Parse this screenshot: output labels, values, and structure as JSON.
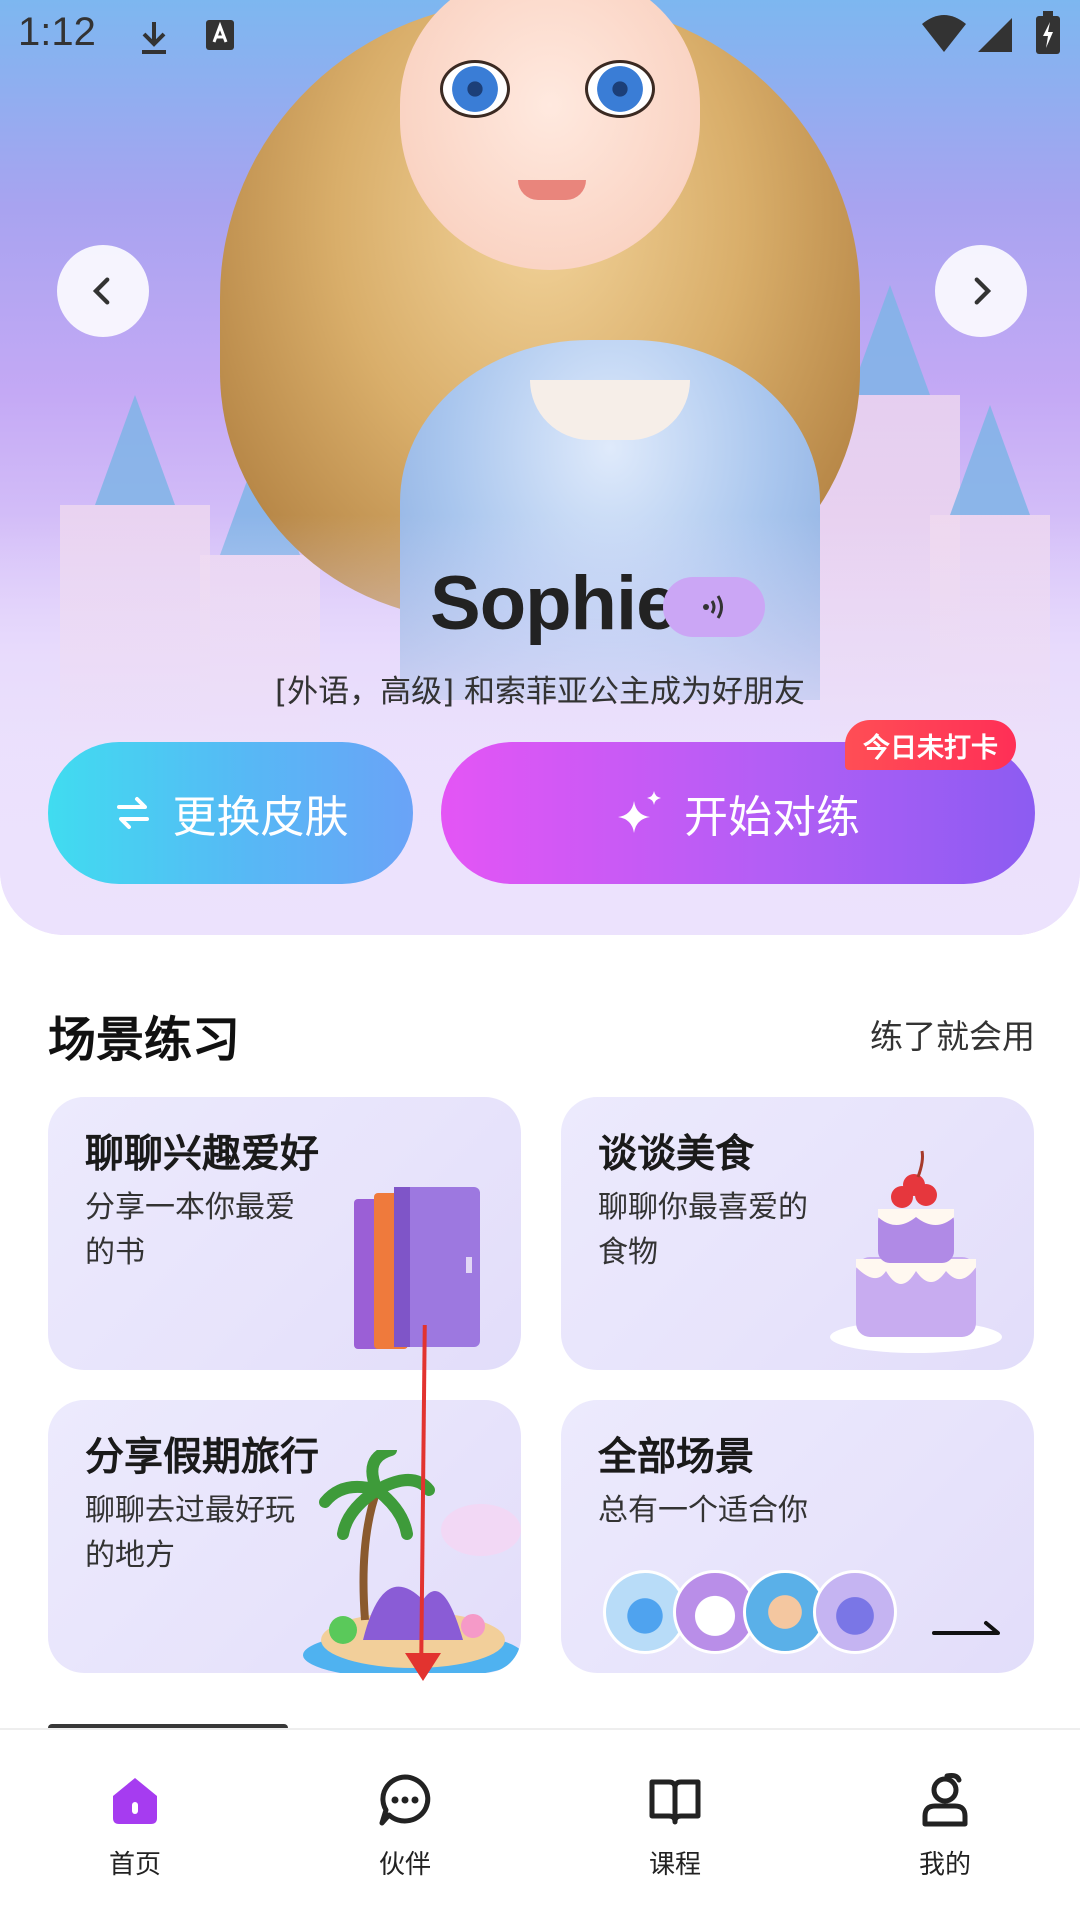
{
  "status_bar": {
    "time": "1:12"
  },
  "hero": {
    "character_name": "Sophie",
    "subtitle": "[外语，高级] 和索菲亚公主成为好朋友",
    "change_skin_label": "更换皮肤",
    "start_practice_label": "开始对练",
    "checkin_badge": "今日未打卡"
  },
  "section": {
    "title": "场景练习",
    "link": "练了就会用",
    "cards": [
      {
        "title": "聊聊兴趣爱好",
        "desc": "分享一本你最爱的书",
        "icon": "books"
      },
      {
        "title": "谈谈美食",
        "desc": "聊聊你最喜爱的食物",
        "icon": "cake"
      },
      {
        "title": "分享假期旅行",
        "desc": "聊聊去过最好玩的地方",
        "icon": "island"
      },
      {
        "title": "全部场景",
        "desc": "总有一个适合你",
        "icon": "avatars"
      }
    ]
  },
  "tabs": [
    {
      "label": "首页",
      "icon": "home-icon",
      "active": true
    },
    {
      "label": "伙伴",
      "icon": "chat-icon",
      "active": false
    },
    {
      "label": "课程",
      "icon": "book-icon",
      "active": false
    },
    {
      "label": "我的",
      "icon": "profile-icon",
      "active": false
    }
  ],
  "colors": {
    "accent_purple": "#8c5cf2",
    "skin_button_start": "#40dcf0",
    "practice_button_start": "#e455f5",
    "badge_red": "#ff3a55"
  }
}
